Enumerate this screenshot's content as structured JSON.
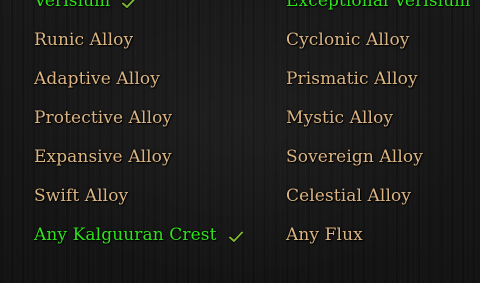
{
  "colors": {
    "normal_text": "#dcb583",
    "owned_text": "#2ee31c",
    "checkmark": "#7fb534",
    "background": "#161616"
  },
  "left_column": [
    {
      "label": "Verisium",
      "owned": true,
      "icon": "checkmark-icon"
    },
    {
      "label": "Runic Alloy",
      "owned": false
    },
    {
      "label": "Adaptive Alloy",
      "owned": false
    },
    {
      "label": "Protective Alloy",
      "owned": false
    },
    {
      "label": "Expansive Alloy",
      "owned": false
    },
    {
      "label": "Swift Alloy",
      "owned": false
    },
    {
      "label": "Any Kalguuran Crest",
      "owned": true,
      "icon": "checkmark-icon"
    }
  ],
  "right_column": [
    {
      "label": "Exceptional Verisium",
      "owned": true
    },
    {
      "label": "Cyclonic Alloy",
      "owned": false
    },
    {
      "label": "Prismatic Alloy",
      "owned": false
    },
    {
      "label": "Mystic Alloy",
      "owned": false
    },
    {
      "label": "Sovereign Alloy",
      "owned": false
    },
    {
      "label": "Celestial Alloy",
      "owned": false
    },
    {
      "label": "Any Flux",
      "owned": false
    }
  ]
}
